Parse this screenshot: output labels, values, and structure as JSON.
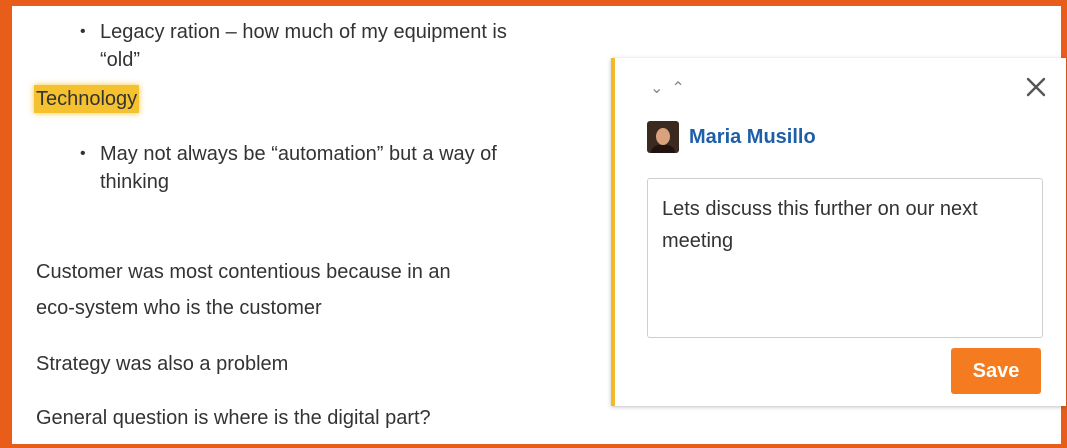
{
  "document": {
    "bullet_1": "Legacy ration – how much of my equipment is “old”",
    "highlighted_heading": "Technology",
    "bullet_2": "May not always be “automation” but a way of thinking",
    "paragraph_1": "Customer was most contentious because in an",
    "paragraph_1_cont": "eco-system who is the customer",
    "paragraph_2": "Strategy was also a problem",
    "paragraph_3": "General question is where is the digital part?",
    "bullet_glyph": "•"
  },
  "comment_panel": {
    "nav_down_glyph": "⌄",
    "nav_up_glyph": "⌃",
    "author": "Maria Musillo",
    "comment_value": "Lets discuss this further on our next meeting",
    "save_label": "Save",
    "accent_color": "#f4b92b",
    "button_color": "#f47b20",
    "author_color": "#1e5fa8"
  },
  "frame": {
    "border_color": "#e85d1a",
    "highlight_color": "#f5c12e"
  },
  "icons": [
    "chevron-down-icon",
    "chevron-up-icon",
    "close-icon",
    "avatar"
  ]
}
